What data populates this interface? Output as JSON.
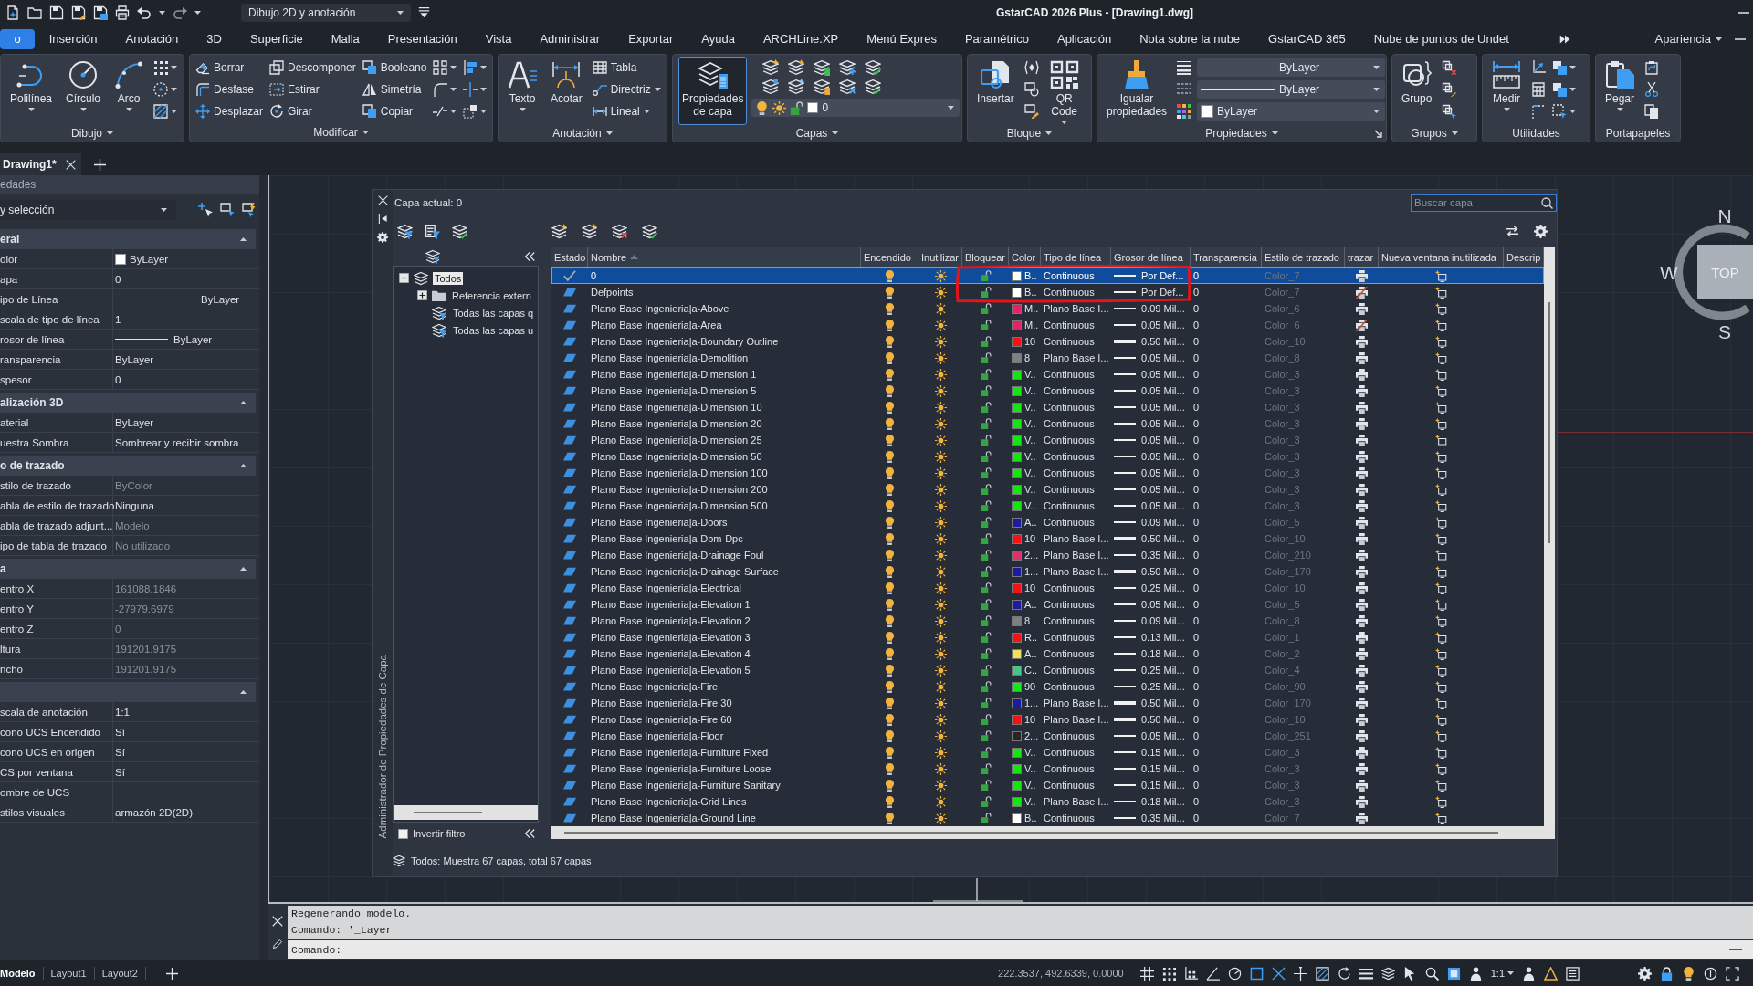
{
  "window": {
    "title": "GstarCAD 2026 Plus - [Drawing1.dwg]",
    "workspace": "Dibujo 2D y anotación"
  },
  "ribbon_tabs": [
    {
      "label": "o",
      "selected": true
    },
    {
      "label": "Inserción",
      "selected": false
    },
    {
      "label": "Anotación",
      "selected": false
    },
    {
      "label": "3D",
      "selected": false
    },
    {
      "label": "Superficie",
      "selected": false
    },
    {
      "label": "Malla",
      "selected": false
    },
    {
      "label": "Presentación",
      "selected": false
    },
    {
      "label": "Vista",
      "selected": false
    },
    {
      "label": "Administrar",
      "selected": false
    },
    {
      "label": "Exportar",
      "selected": false
    },
    {
      "label": "Ayuda",
      "selected": false
    },
    {
      "label": "ARCHLine.XP",
      "selected": false
    },
    {
      "label": "Menú Expres",
      "selected": false
    },
    {
      "label": "Paramétrico",
      "selected": false
    },
    {
      "label": "Aplicación",
      "selected": false
    },
    {
      "label": "Nota sobre la nube",
      "selected": false
    },
    {
      "label": "GstarCAD 365",
      "selected": false
    },
    {
      "label": "Nube de puntos de Undet",
      "selected": false
    }
  ],
  "appearance_menu": "Apariencia",
  "ribbon_panels": [
    {
      "title": "Dibujo",
      "menu": true,
      "items": [
        {
          "kind": "large",
          "label": "Polilínea",
          "dropdown": true,
          "active": false
        },
        {
          "kind": "large",
          "label": "Círculo",
          "dropdown": true,
          "active": false
        },
        {
          "kind": "large",
          "label": "Arco",
          "dropdown": true,
          "active": false
        },
        {
          "kind": "icon",
          "dropdown": true
        },
        {
          "kind": "icon",
          "dropdown": true
        },
        {
          "kind": "icon",
          "dropdown": true
        }
      ]
    },
    {
      "title": "Modificar",
      "menu": true,
      "items": [
        {
          "kind": "small",
          "label": "Borrar",
          "dropdown": false
        },
        {
          "kind": "small",
          "label": "Desfase",
          "dropdown": false
        },
        {
          "kind": "small",
          "label": "Desplazar",
          "dropdown": false
        },
        {
          "kind": "small",
          "label": "Descomponer",
          "dropdown": false
        },
        {
          "kind": "small",
          "label": "Estirar",
          "dropdown": false
        },
        {
          "kind": "small",
          "label": "Girar",
          "dropdown": false
        },
        {
          "kind": "small",
          "label": "Booleano",
          "dropdown": false
        },
        {
          "kind": "small",
          "label": "Simetría",
          "dropdown": false
        },
        {
          "kind": "small",
          "label": "Copiar",
          "dropdown": false
        },
        {
          "kind": "icon",
          "dropdown": true
        },
        {
          "kind": "icon",
          "dropdown": true
        },
        {
          "kind": "icon",
          "dropdown": true
        },
        {
          "kind": "icon",
          "dropdown": true
        },
        {
          "kind": "icon",
          "dropdown": true
        },
        {
          "kind": "icon",
          "dropdown": true
        }
      ]
    },
    {
      "title": "Anotación",
      "menu": true,
      "items": [
        {
          "kind": "large",
          "label": "Texto",
          "dropdown": true,
          "active": false
        },
        {
          "kind": "large",
          "label": "Acotar",
          "dropdown": false,
          "active": false
        },
        {
          "kind": "small",
          "label": "Tabla",
          "dropdown": false
        },
        {
          "kind": "small",
          "label": "Directriz",
          "dropdown": true
        },
        {
          "kind": "small",
          "label": "Lineal",
          "dropdown": true
        }
      ]
    },
    {
      "title": "Capas",
      "menu": true,
      "items": [
        {
          "kind": "large",
          "label": "Propiedades de capa",
          "dropdown": false,
          "active": true
        },
        {
          "kind": "layer_box",
          "value": "0",
          "on": true,
          "frozen": false,
          "locked": false,
          "color": "#ffffff"
        }
      ]
    },
    {
      "title": "Bloque",
      "menu": true,
      "items": [
        {
          "kind": "large",
          "label": "Insertar",
          "dropdown": false,
          "active": false
        },
        {
          "kind": "icon",
          "dropdown": false
        },
        {
          "kind": "icon",
          "dropdown": false
        },
        {
          "kind": "icon",
          "dropdown": false
        },
        {
          "kind": "large",
          "label": "QR Code",
          "dropdown": true,
          "active": false
        }
      ]
    },
    {
      "title": "Propiedades",
      "menu": true,
      "launcher": true,
      "items": [
        {
          "kind": "large",
          "label": "Igualar propiedades",
          "dropdown": false,
          "active": false
        },
        {
          "kind": "combo",
          "value": "ByLayer"
        },
        {
          "kind": "combo",
          "value": "ByLayer"
        },
        {
          "kind": "combo",
          "color": "#ffffff",
          "value": "ByLayer"
        }
      ]
    },
    {
      "title": "Grupos",
      "menu": true,
      "items": [
        {
          "kind": "large",
          "label": "Grupo",
          "dropdown": false,
          "active": false
        },
        {
          "kind": "icon",
          "dropdown": false
        },
        {
          "kind": "icon",
          "dropdown": false
        },
        {
          "kind": "icon",
          "dropdown": false
        }
      ]
    },
    {
      "title": "Utilidades",
      "menu": false,
      "items": [
        {
          "kind": "large",
          "label": "Medir",
          "dropdown": true,
          "active": false
        },
        {
          "kind": "icon",
          "dropdown": false
        },
        {
          "kind": "icon",
          "dropdown": false
        },
        {
          "kind": "icon",
          "dropdown": false
        },
        {
          "kind": "icon",
          "dropdown": true
        },
        {
          "kind": "icon",
          "dropdown": true
        },
        {
          "kind": "icon",
          "dropdown": true
        }
      ]
    },
    {
      "title": "Portapapeles",
      "menu": false,
      "items": [
        {
          "kind": "large",
          "label": "Pegar",
          "dropdown": true,
          "active": false
        },
        {
          "kind": "icon",
          "dropdown": false
        },
        {
          "kind": "icon",
          "dropdown": false
        },
        {
          "kind": "icon",
          "dropdown": false
        }
      ]
    }
  ],
  "document_tabs": [
    {
      "label": "Drawing1*",
      "selected": true
    }
  ],
  "properties": {
    "title": "edades",
    "selector": "y selección",
    "sections": [
      {
        "title": "eral",
        "expanded": true,
        "rows": [
          {
            "label": "olor",
            "kind": "swatch",
            "color": "#ffffff",
            "value": "ByLayer",
            "disabled": false
          },
          {
            "label": "apa",
            "kind": "text",
            "value": "0",
            "disabled": false
          },
          {
            "label": "ipo de Línea",
            "kind": "linetype",
            "value": "ByLayer",
            "disabled": false
          },
          {
            "label": "scala de tipo de línea",
            "kind": "text",
            "value": "1",
            "disabled": false
          },
          {
            "label": "rosor de línea",
            "kind": "lineweight",
            "value": "ByLayer",
            "disabled": false
          },
          {
            "label": "ransparencia",
            "kind": "text",
            "value": "ByLayer",
            "disabled": false
          },
          {
            "label": "spesor",
            "kind": "text",
            "value": "0",
            "disabled": false
          }
        ]
      },
      {
        "title": "alización 3D",
        "expanded": true,
        "rows": [
          {
            "label": "aterial",
            "kind": "text",
            "value": "ByLayer",
            "disabled": false
          },
          {
            "label": "uestra Sombra",
            "kind": "text",
            "value": "Sombrear y recibir sombra",
            "disabled": false
          }
        ]
      },
      {
        "title": "o de trazado",
        "expanded": true,
        "rows": [
          {
            "label": "stilo de trazado",
            "kind": "text",
            "value": "ByColor",
            "disabled": true
          },
          {
            "label": "abla de estilo de trazado",
            "kind": "text",
            "value": "Ninguna",
            "disabled": false
          },
          {
            "label": "abla de trazado adjunt...",
            "kind": "text",
            "value": "Modelo",
            "disabled": true
          },
          {
            "label": "ipo de tabla de trazado",
            "kind": "text",
            "value": "No utilizado",
            "disabled": true
          }
        ]
      },
      {
        "title": "a",
        "expanded": true,
        "rows": [
          {
            "label": "entro X",
            "kind": "text",
            "value": "161088.1846",
            "disabled": true
          },
          {
            "label": "entro Y",
            "kind": "text",
            "value": "-27979.6979",
            "disabled": true
          },
          {
            "label": "entro Z",
            "kind": "text",
            "value": "0",
            "disabled": true
          },
          {
            "label": "ltura",
            "kind": "text",
            "value": "191201.9175",
            "disabled": true
          },
          {
            "label": "ncho",
            "kind": "text",
            "value": "191201.9175",
            "disabled": true
          }
        ]
      },
      {
        "expanded": true,
        "rows": [
          {
            "label": "scala de anotación",
            "kind": "text",
            "value": "1:1",
            "disabled": false
          },
          {
            "label": "cono UCS Encendido",
            "kind": "text",
            "value": "Sí",
            "disabled": false
          },
          {
            "label": "cono UCS en origen",
            "kind": "text",
            "value": "Sí",
            "disabled": false
          },
          {
            "label": "CS por ventana",
            "kind": "text",
            "value": "Sí",
            "disabled": false
          },
          {
            "label": "ombre de UCS",
            "kind": "text"
          },
          {
            "label": "stilos visuales",
            "kind": "text",
            "value": "armazón 2D(2D)",
            "disabled": false
          }
        ]
      }
    ]
  },
  "layer_manager": {
    "side_title": "Administrador de Propiedades de Capa",
    "current_layer": "Capa actual: 0",
    "search": {
      "placeholder": "Buscar capa"
    },
    "filters": [
      {
        "label": "Todos",
        "kind": "all",
        "selected": true,
        "expanded": true,
        "children": [
          {
            "label": "Referencia extern",
            "kind": "xref",
            "selected": false,
            "expanded": false
          },
          {
            "label": "Todas las capas q",
            "kind": "filter",
            "selected": false
          },
          {
            "label": "Todas las capas u",
            "kind": "filter",
            "selected": false
          }
        ]
      }
    ],
    "invert_filter": {
      "label": "Invertir filtro",
      "checked": false
    },
    "columns": [
      {
        "label": "Estado",
        "sorted": false
      },
      {
        "label": "Nombre",
        "sorted": true
      },
      {
        "label": "Encendido",
        "sorted": false
      },
      {
        "label": "Inutilizar",
        "sorted": false
      },
      {
        "label": "Bloquear",
        "sorted": false
      },
      {
        "label": "Color",
        "sorted": false
      },
      {
        "label": "Tipo de línea",
        "sorted": false
      },
      {
        "label": "Grosor de línea",
        "sorted": false
      },
      {
        "label": "Transparencia",
        "sorted": false
      },
      {
        "label": "Estilo de trazado",
        "sorted": false
      },
      {
        "label": "trazar",
        "sorted": false
      },
      {
        "label": "Nueva ventana inutilizada",
        "sorted": false
      },
      {
        "label": "Descrip",
        "sorted": false
      }
    ],
    "layers": [
      {
        "name": "0",
        "current": true,
        "selected": true,
        "marked": true,
        "on": true,
        "frozen": false,
        "locked": false,
        "color": "#ffffff",
        "color_name": "B..",
        "linetype": "Continuous",
        "lineweight": "Por Def...",
        "thick": false,
        "transparency": "0",
        "plot_style": "Color_7",
        "plot": true
      },
      {
        "name": "Defpoints",
        "current": false,
        "selected": false,
        "marked": true,
        "on": true,
        "frozen": false,
        "locked": false,
        "color": "#ffffff",
        "color_name": "B..",
        "linetype": "Continuous",
        "lineweight": "Por Def...",
        "thick": false,
        "transparency": "0",
        "plot_style": "Color_7",
        "plot": false
      },
      {
        "name": "Plano Base Ingenieria|a-Above",
        "current": false,
        "selected": false,
        "marked": false,
        "on": true,
        "frozen": false,
        "locked": false,
        "color": "#e8206a",
        "color_name": "M..",
        "linetype": "Plano Base I...",
        "lineweight": "0.09 Mil...",
        "thick": false,
        "transparency": "0",
        "plot_style": "Color_6",
        "plot": true
      },
      {
        "name": "Plano Base Ingenieria|a-Area",
        "current": false,
        "selected": false,
        "marked": false,
        "on": true,
        "frozen": false,
        "locked": false,
        "color": "#e8206a",
        "color_name": "M..",
        "linetype": "Continuous",
        "lineweight": "0.05 Mil...",
        "thick": false,
        "transparency": "0",
        "plot_style": "Color_6",
        "plot": false
      },
      {
        "name": "Plano Base Ingenieria|a-Boundary Outline",
        "current": false,
        "selected": false,
        "marked": false,
        "on": true,
        "frozen": false,
        "locked": false,
        "color": "#f01414",
        "color_name": "10",
        "linetype": "Continuous",
        "lineweight": "0.50 Mil...",
        "thick": true,
        "transparency": "0",
        "plot_style": "Color_10",
        "plot": true
      },
      {
        "name": "Plano Base Ingenieria|a-Demolition",
        "current": false,
        "selected": false,
        "marked": false,
        "on": true,
        "frozen": false,
        "locked": false,
        "color": "#808080",
        "color_name": "8",
        "linetype": "Plano Base I...",
        "lineweight": "0.05 Mil...",
        "thick": false,
        "transparency": "0",
        "plot_style": "Color_8",
        "plot": true
      },
      {
        "name": "Plano Base Ingenieria|a-Dimension 1",
        "current": false,
        "selected": false,
        "marked": false,
        "on": true,
        "frozen": false,
        "locked": false,
        "color": "#14e614",
        "color_name": "V..",
        "linetype": "Continuous",
        "lineweight": "0.05 Mil...",
        "thick": false,
        "transparency": "0",
        "plot_style": "Color_3",
        "plot": true
      },
      {
        "name": "Plano Base Ingenieria|a-Dimension 5",
        "current": false,
        "selected": false,
        "marked": false,
        "on": true,
        "frozen": false,
        "locked": false,
        "color": "#14e614",
        "color_name": "V..",
        "linetype": "Continuous",
        "lineweight": "0.05 Mil...",
        "thick": false,
        "transparency": "0",
        "plot_style": "Color_3",
        "plot": true
      },
      {
        "name": "Plano Base Ingenieria|a-Dimension 10",
        "current": false,
        "selected": false,
        "marked": false,
        "on": true,
        "frozen": false,
        "locked": false,
        "color": "#14e614",
        "color_name": "V..",
        "linetype": "Continuous",
        "lineweight": "0.05 Mil...",
        "thick": false,
        "transparency": "0",
        "plot_style": "Color_3",
        "plot": true
      },
      {
        "name": "Plano Base Ingenieria|a-Dimension 20",
        "current": false,
        "selected": false,
        "marked": false,
        "on": true,
        "frozen": false,
        "locked": false,
        "color": "#14e614",
        "color_name": "V..",
        "linetype": "Continuous",
        "lineweight": "0.05 Mil...",
        "thick": false,
        "transparency": "0",
        "plot_style": "Color_3",
        "plot": true
      },
      {
        "name": "Plano Base Ingenieria|a-Dimension 25",
        "current": false,
        "selected": false,
        "marked": false,
        "on": true,
        "frozen": false,
        "locked": false,
        "color": "#14e614",
        "color_name": "V..",
        "linetype": "Continuous",
        "lineweight": "0.05 Mil...",
        "thick": false,
        "transparency": "0",
        "plot_style": "Color_3",
        "plot": true
      },
      {
        "name": "Plano Base Ingenieria|a-Dimension 50",
        "current": false,
        "selected": false,
        "marked": false,
        "on": true,
        "frozen": false,
        "locked": false,
        "color": "#14e614",
        "color_name": "V..",
        "linetype": "Continuous",
        "lineweight": "0.05 Mil...",
        "thick": false,
        "transparency": "0",
        "plot_style": "Color_3",
        "plot": true
      },
      {
        "name": "Plano Base Ingenieria|a-Dimension 100",
        "current": false,
        "selected": false,
        "marked": false,
        "on": true,
        "frozen": false,
        "locked": false,
        "color": "#14e614",
        "color_name": "V..",
        "linetype": "Continuous",
        "lineweight": "0.05 Mil...",
        "thick": false,
        "transparency": "0",
        "plot_style": "Color_3",
        "plot": true
      },
      {
        "name": "Plano Base Ingenieria|a-Dimension 200",
        "current": false,
        "selected": false,
        "marked": false,
        "on": true,
        "frozen": false,
        "locked": false,
        "color": "#14e614",
        "color_name": "V..",
        "linetype": "Continuous",
        "lineweight": "0.05 Mil...",
        "thick": false,
        "transparency": "0",
        "plot_style": "Color_3",
        "plot": true
      },
      {
        "name": "Plano Base Ingenieria|a-Dimension 500",
        "current": false,
        "selected": false,
        "marked": false,
        "on": true,
        "frozen": false,
        "locked": false,
        "color": "#14e614",
        "color_name": "V..",
        "linetype": "Continuous",
        "lineweight": "0.05 Mil...",
        "thick": false,
        "transparency": "0",
        "plot_style": "Color_3",
        "plot": true
      },
      {
        "name": "Plano Base Ingenieria|a-Doors",
        "current": false,
        "selected": false,
        "marked": false,
        "on": true,
        "frozen": false,
        "locked": false,
        "color": "#1c1ca0",
        "color_name": "A..",
        "linetype": "Continuous",
        "lineweight": "0.09 Mil...",
        "thick": false,
        "transparency": "0",
        "plot_style": "Color_5",
        "plot": true
      },
      {
        "name": "Plano Base Ingenieria|a-Dpm-Dpc",
        "current": false,
        "selected": false,
        "marked": false,
        "on": true,
        "frozen": false,
        "locked": false,
        "color": "#f01414",
        "color_name": "10",
        "linetype": "Plano Base I...",
        "lineweight": "0.50 Mil...",
        "thick": true,
        "transparency": "0",
        "plot_style": "Color_10",
        "plot": true
      },
      {
        "name": "Plano Base Ingenieria|a-Drainage Foul",
        "current": false,
        "selected": false,
        "marked": false,
        "on": true,
        "frozen": false,
        "locked": false,
        "color": "#e0306a",
        "color_name": "2...",
        "linetype": "Plano Base I...",
        "lineweight": "0.35 Mil...",
        "thick": false,
        "transparency": "0",
        "plot_style": "Color_210",
        "plot": true
      },
      {
        "name": "Plano Base Ingenieria|a-Drainage Surface",
        "current": false,
        "selected": false,
        "marked": false,
        "on": true,
        "frozen": false,
        "locked": false,
        "color": "#1c1ca0",
        "color_name": "1...",
        "linetype": "Plano Base I...",
        "lineweight": "0.50 Mil...",
        "thick": true,
        "transparency": "0",
        "plot_style": "Color_170",
        "plot": true
      },
      {
        "name": "Plano Base Ingenieria|a-Electrical",
        "current": false,
        "selected": false,
        "marked": false,
        "on": true,
        "frozen": false,
        "locked": false,
        "color": "#f01414",
        "color_name": "10",
        "linetype": "Continuous",
        "lineweight": "0.25 Mil...",
        "thick": false,
        "transparency": "0",
        "plot_style": "Color_10",
        "plot": true
      },
      {
        "name": "Plano Base Ingenieria|a-Elevation 1",
        "current": false,
        "selected": false,
        "marked": false,
        "on": true,
        "frozen": false,
        "locked": false,
        "color": "#1c1ca0",
        "color_name": "A..",
        "linetype": "Continuous",
        "lineweight": "0.05 Mil...",
        "thick": false,
        "transparency": "0",
        "plot_style": "Color_5",
        "plot": true
      },
      {
        "name": "Plano Base Ingenieria|a-Elevation 2",
        "current": false,
        "selected": false,
        "marked": false,
        "on": true,
        "frozen": false,
        "locked": false,
        "color": "#808080",
        "color_name": "8",
        "linetype": "Continuous",
        "lineweight": "0.09 Mil...",
        "thick": false,
        "transparency": "0",
        "plot_style": "Color_8",
        "plot": true
      },
      {
        "name": "Plano Base Ingenieria|a-Elevation 3",
        "current": false,
        "selected": false,
        "marked": false,
        "on": true,
        "frozen": false,
        "locked": false,
        "color": "#f01414",
        "color_name": "R..",
        "linetype": "Continuous",
        "lineweight": "0.13 Mil...",
        "thick": false,
        "transparency": "0",
        "plot_style": "Color_1",
        "plot": true
      },
      {
        "name": "Plano Base Ingenieria|a-Elevation 4",
        "current": false,
        "selected": false,
        "marked": false,
        "on": true,
        "frozen": false,
        "locked": false,
        "color": "#f2e25a",
        "color_name": "A..",
        "linetype": "Continuous",
        "lineweight": "0.18 Mil...",
        "thick": false,
        "transparency": "0",
        "plot_style": "Color_2",
        "plot": true
      },
      {
        "name": "Plano Base Ingenieria|a-Elevation 5",
        "current": false,
        "selected": false,
        "marked": false,
        "on": true,
        "frozen": false,
        "locked": false,
        "color": "#4cc38a",
        "color_name": "C..",
        "linetype": "Continuous",
        "lineweight": "0.25 Mil...",
        "thick": false,
        "transparency": "0",
        "plot_style": "Color_4",
        "plot": true
      },
      {
        "name": "Plano Base Ingenieria|a-Fire",
        "current": false,
        "selected": false,
        "marked": false,
        "on": true,
        "frozen": false,
        "locked": false,
        "color": "#12e81a",
        "color_name": "90",
        "linetype": "Continuous",
        "lineweight": "0.25 Mil...",
        "thick": false,
        "transparency": "0",
        "plot_style": "Color_90",
        "plot": true
      },
      {
        "name": "Plano Base Ingenieria|a-Fire 30",
        "current": false,
        "selected": false,
        "marked": false,
        "on": true,
        "frozen": false,
        "locked": false,
        "color": "#1c1ca0",
        "color_name": "1...",
        "linetype": "Plano Base I...",
        "lineweight": "0.50 Mil...",
        "thick": true,
        "transparency": "0",
        "plot_style": "Color_170",
        "plot": true
      },
      {
        "name": "Plano Base Ingenieria|a-Fire 60",
        "current": false,
        "selected": false,
        "marked": false,
        "on": true,
        "frozen": false,
        "locked": false,
        "color": "#f01414",
        "color_name": "10",
        "linetype": "Plano Base I...",
        "lineweight": "0.50 Mil...",
        "thick": true,
        "transparency": "0",
        "plot_style": "Color_10",
        "plot": true
      },
      {
        "name": "Plano Base Ingenieria|a-Floor",
        "current": false,
        "selected": false,
        "marked": false,
        "on": true,
        "frozen": false,
        "locked": false,
        "color": "#262626",
        "color_name": "2...",
        "linetype": "Continuous",
        "lineweight": "0.05 Mil...",
        "thick": false,
        "transparency": "0",
        "plot_style": "Color_251",
        "plot": true
      },
      {
        "name": "Plano Base Ingenieria|a-Furniture Fixed",
        "current": false,
        "selected": false,
        "marked": false,
        "on": true,
        "frozen": false,
        "locked": false,
        "color": "#14e614",
        "color_name": "V..",
        "linetype": "Continuous",
        "lineweight": "0.15 Mil...",
        "thick": false,
        "transparency": "0",
        "plot_style": "Color_3",
        "plot": true
      },
      {
        "name": "Plano Base Ingenieria|a-Furniture Loose",
        "current": false,
        "selected": false,
        "marked": false,
        "on": true,
        "frozen": false,
        "locked": false,
        "color": "#14e614",
        "color_name": "V..",
        "linetype": "Continuous",
        "lineweight": "0.15 Mil...",
        "thick": false,
        "transparency": "0",
        "plot_style": "Color_3",
        "plot": true
      },
      {
        "name": "Plano Base Ingenieria|a-Furniture Sanitary",
        "current": false,
        "selected": false,
        "marked": false,
        "on": true,
        "frozen": false,
        "locked": false,
        "color": "#14e614",
        "color_name": "V..",
        "linetype": "Continuous",
        "lineweight": "0.15 Mil...",
        "thick": false,
        "transparency": "0",
        "plot_style": "Color_3",
        "plot": true
      },
      {
        "name": "Plano Base Ingenieria|a-Grid Lines",
        "current": false,
        "selected": false,
        "marked": false,
        "on": true,
        "frozen": false,
        "locked": false,
        "color": "#14e614",
        "color_name": "V..",
        "linetype": "Plano Base I...",
        "lineweight": "0.18 Mil...",
        "thick": false,
        "transparency": "0",
        "plot_style": "Color_3",
        "plot": true
      },
      {
        "name": "Plano Base Ingenieria|a-Ground Line",
        "current": false,
        "selected": false,
        "marked": false,
        "on": true,
        "frozen": false,
        "locked": false,
        "color": "#ffffff",
        "color_name": "B..",
        "linetype": "Continuous",
        "lineweight": "0.35 Mil...",
        "thick": false,
        "transparency": "0",
        "plot_style": "Color_7",
        "plot": true
      }
    ],
    "status": "Todos: Muestra 67 capas, total 67 capas"
  },
  "viewcube": {
    "face": "TOP",
    "directions": [
      "N",
      "W",
      "S"
    ]
  },
  "command_line": {
    "history": [
      "Regenerando modelo.",
      "Comando: '_Layer"
    ],
    "prompt": "Comando:"
  },
  "status_bar": {
    "layouts": [
      {
        "label": "Modelo",
        "selected": true
      },
      {
        "label": "Layout1",
        "selected": false
      },
      {
        "label": "Layout2",
        "selected": false
      }
    ],
    "coordinates": "222.3537, 492.6339, 0.0000",
    "annotation_scale": "1:1"
  }
}
